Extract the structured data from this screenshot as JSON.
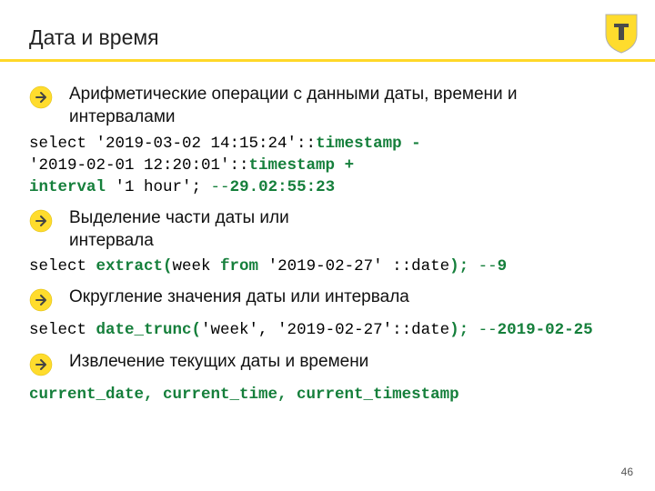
{
  "title": "Дата и время",
  "bullets": {
    "b1": "Арифметические операции с данными даты, времени и интервалами",
    "b2": "Выделение части даты или интервала",
    "b3": "Округление значения даты или интервала",
    "b4": "Извлечение текущих даты и времени"
  },
  "code": {
    "c1_l1a": "select '2019-03-02 14:15:24'::",
    "c1_l1b": "timestamp -",
    "c1_l2a": "'2019-02-01 12:20:01'::",
    "c1_l2b": "timestamp +",
    "c1_l3a": "interval",
    "c1_l3b": " '1 hour'; ",
    "c1_l3c": "--",
    "c1_l3d": "29.02:55:23",
    "c2_a": "select ",
    "c2_b": "extract(",
    "c2_c": "week ",
    "c2_d": "from",
    "c2_e": " '2019-02-27' ::date",
    "c2_f": ");",
    "c2_g": " --",
    "c2_h": "9",
    "c3_a": "select ",
    "c3_b": "date_trunc(",
    "c3_c": "'week', '2019-02-27'::date",
    "c3_d": ");",
    "c3_e": " --",
    "c3_f": "2019-02-25",
    "c4": "current_date, current_time, current_timestamp"
  },
  "page": "46"
}
